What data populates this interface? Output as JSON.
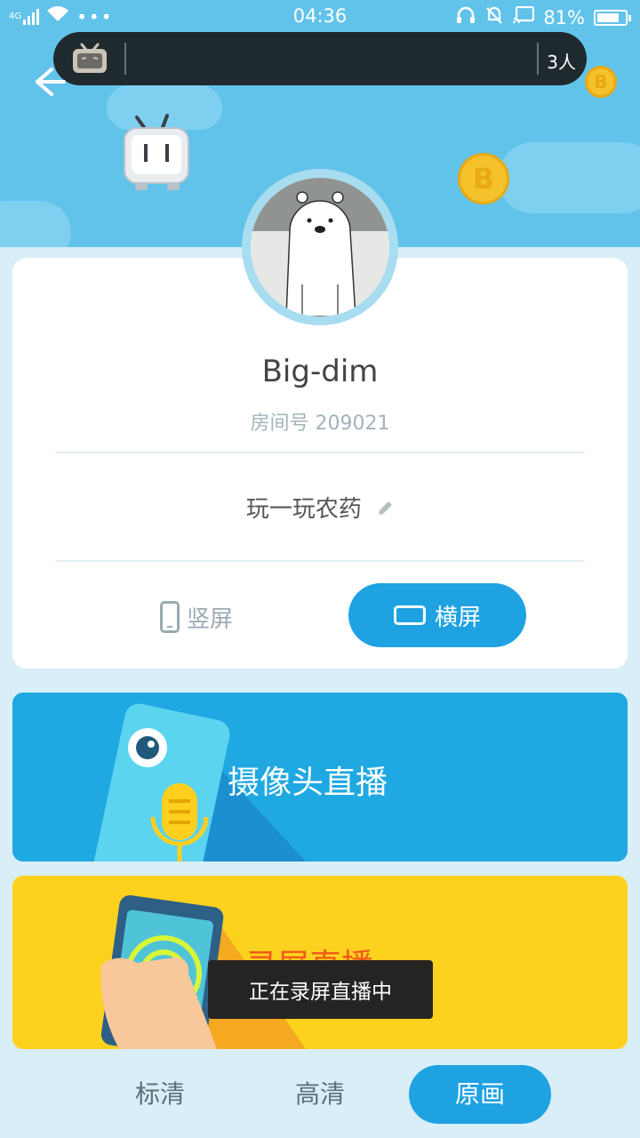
{
  "status_bar": {
    "network": "4G",
    "time": "04:36",
    "battery_percent": "81%",
    "battery_level": 0.81
  },
  "overlay": {
    "viewer_count": "3人"
  },
  "profile": {
    "username": "Big-dim",
    "room_id": "房间号 209021",
    "stream_title": "玩一玩农药"
  },
  "orientation": {
    "portrait_label": "竖屏",
    "landscape_label": "横屏",
    "selected": "landscape"
  },
  "modes": {
    "camera_label": "摄像头直播",
    "screen_label": "录屏直播"
  },
  "toast": {
    "message": "正在录屏直播中"
  },
  "quality": {
    "options": [
      "标清",
      "高清",
      "原画"
    ],
    "selected": "原画"
  },
  "colors": {
    "header_blue": "#62c3ea",
    "accent_blue": "#1ea2e2",
    "camera_banner": "#1fa8e2",
    "screen_banner": "#fcd21e",
    "screen_label": "#f05a1a"
  }
}
